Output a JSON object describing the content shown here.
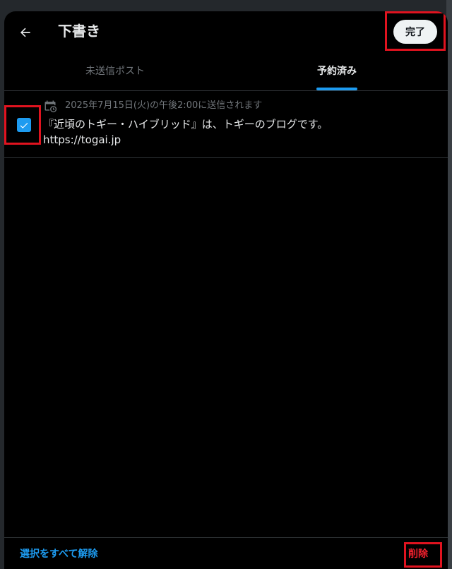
{
  "header": {
    "title": "下書き",
    "done_label": "完了"
  },
  "tabs": [
    {
      "label": "未送信ポスト",
      "active": false
    },
    {
      "label": "予約済み",
      "active": true
    }
  ],
  "drafts": [
    {
      "checked": true,
      "schedule": "2025年7月15日(火)の午後2:00に送信されます",
      "text_line1": "『近頃のトギー・ハイブリッド』は、トギーのブログです。",
      "text_line2": "https://togai.jp"
    }
  ],
  "footer": {
    "deselect_all_label": "選択をすべて解除",
    "delete_label": "削除"
  },
  "colors": {
    "accent": "#1d9bf0",
    "danger": "#f4212e",
    "highlight_frame": "#e0131f",
    "background": "#000000"
  },
  "icons": {
    "back": "arrow-left-icon",
    "schedule": "calendar-clock-icon",
    "check": "checkmark-icon"
  }
}
